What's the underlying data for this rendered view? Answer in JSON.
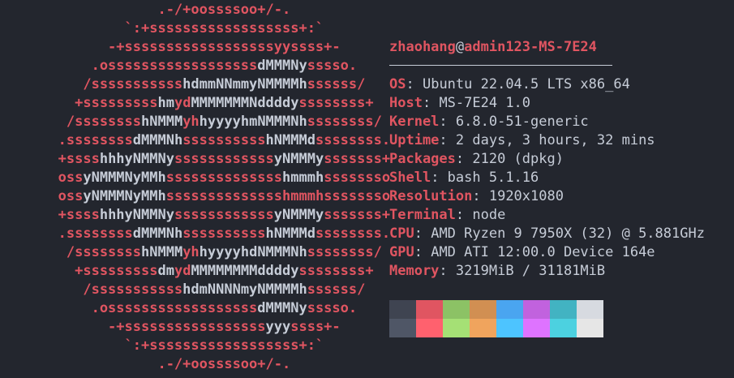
{
  "logo": {
    "lines": [
      [
        [
          "r",
          "                   .-/+oossssoo+/-."
        ]
      ],
      [
        [
          "r",
          "               `:+ssssssssssssssssss+:`"
        ]
      ],
      [
        [
          "r",
          "             -+ssssssssssssssssssyyssss+-"
        ]
      ],
      [
        [
          "r",
          "           .ossssssssssssssssss"
        ],
        [
          "w",
          "dMMMNy"
        ],
        [
          "r",
          "sssso."
        ]
      ],
      [
        [
          "r",
          "          /sssssssssss"
        ],
        [
          "w",
          "hdmmNNmmyNMMMMh"
        ],
        [
          "r",
          "ssssss/"
        ]
      ],
      [
        [
          "r",
          "         +sssssssss"
        ],
        [
          "w",
          "hm"
        ],
        [
          "r",
          "yd"
        ],
        [
          "w",
          "MMMMMMMNddddy"
        ],
        [
          "r",
          "ssssssss+"
        ]
      ],
      [
        [
          "r",
          "        /ssssssss"
        ],
        [
          "w",
          "hNMMM"
        ],
        [
          "r",
          "yh"
        ],
        [
          "w",
          "hyyyyhmNMMMNh"
        ],
        [
          "r",
          "ssssssss/"
        ]
      ],
      [
        [
          "r",
          "       .ssssssss"
        ],
        [
          "w",
          "dMMMNh"
        ],
        [
          "r",
          "ssssssssss"
        ],
        [
          "w",
          "hNMMMd"
        ],
        [
          "r",
          "ssssssss."
        ]
      ],
      [
        [
          "r",
          "       +ssss"
        ],
        [
          "w",
          "hhhyNMMNy"
        ],
        [
          "r",
          "ssssssssssss"
        ],
        [
          "w",
          "yNMMMy"
        ],
        [
          "r",
          "sssssss+"
        ]
      ],
      [
        [
          "r",
          "       oss"
        ],
        [
          "w",
          "yNMMMNyMMh"
        ],
        [
          "r",
          "ssssssssssssss"
        ],
        [
          "w",
          "hmmmh"
        ],
        [
          "r",
          "ssssssso"
        ]
      ],
      [
        [
          "r",
          "       oss"
        ],
        [
          "w",
          "yNMMMNyMMh"
        ],
        [
          "r",
          "sssssssssssssshmmmh"
        ],
        [
          "w",
          ""
        ],
        [
          "r",
          "ssssssso"
        ]
      ],
      [
        [
          "r",
          "       +ssss"
        ],
        [
          "w",
          "hhhyNMMNy"
        ],
        [
          "r",
          "ssssssssssss"
        ],
        [
          "w",
          "yNMMMy"
        ],
        [
          "r",
          "sssssss+"
        ]
      ],
      [
        [
          "r",
          "       .ssssssss"
        ],
        [
          "w",
          "dMMMNh"
        ],
        [
          "r",
          "ssssssssss"
        ],
        [
          "w",
          "hNMMMd"
        ],
        [
          "r",
          "ssssssss."
        ]
      ],
      [
        [
          "r",
          "        /ssssssss"
        ],
        [
          "w",
          "hNMMM"
        ],
        [
          "r",
          "yh"
        ],
        [
          "w",
          "hyyyyhdNMMMNh"
        ],
        [
          "r",
          "ssssssss/"
        ]
      ],
      [
        [
          "r",
          "         +sssssssss"
        ],
        [
          "w",
          "dm"
        ],
        [
          "r",
          "yd"
        ],
        [
          "w",
          "MMMMMMMMddddy"
        ],
        [
          "r",
          "ssssssss+"
        ]
      ],
      [
        [
          "r",
          "          /sssssssssss"
        ],
        [
          "w",
          "hdmNNNNmyNMMMMh"
        ],
        [
          "r",
          "ssssss/"
        ]
      ],
      [
        [
          "r",
          "           .ossssssssssssssssss"
        ],
        [
          "w",
          "dMMMNy"
        ],
        [
          "r",
          "sssso."
        ]
      ],
      [
        [
          "r",
          "             -+sssssssssssssssss"
        ],
        [
          "w",
          "yyy"
        ],
        [
          "r",
          "ssss+-"
        ]
      ],
      [
        [
          "r",
          "               `:+ssssssssssssssssss+:`"
        ]
      ],
      [
        [
          "r",
          "                   .-/+oossssoo+/-."
        ]
      ]
    ]
  },
  "title": {
    "user": "zhaohang",
    "at": "@",
    "host": "admin123-MS-7E24"
  },
  "info": [
    {
      "key": "OS",
      "value": "Ubuntu 22.04.5 LTS x86_64"
    },
    {
      "key": "Host",
      "value": "MS-7E24 1.0"
    },
    {
      "key": "Kernel",
      "value": "6.8.0-51-generic"
    },
    {
      "key": "Uptime",
      "value": "2 days, 3 hours, 32 mins"
    },
    {
      "key": "Packages",
      "value": "2120 (dpkg)"
    },
    {
      "key": "Shell",
      "value": "bash 5.1.16"
    },
    {
      "key": "Resolution",
      "value": "1920x1080"
    },
    {
      "key": "Terminal",
      "value": "node"
    },
    {
      "key": "CPU",
      "value": "AMD Ryzen 9 7950X (32) @ 5.881GHz"
    },
    {
      "key": "GPU",
      "value": "AMD ATI 12:00.0 Device 164e"
    },
    {
      "key": "Memory",
      "value": "3219MiB / 31181MiB"
    }
  ],
  "palette": {
    "normal": [
      "#3f4451",
      "#e05561",
      "#8cc265",
      "#d18f52",
      "#4aa5f0",
      "#c162de",
      "#42b3c2",
      "#d7dae0"
    ],
    "bright": [
      "#4f5666",
      "#ff616e",
      "#a5e075",
      "#f0a45d",
      "#4dc4ff",
      "#de73ff",
      "#4cd1e0",
      "#e6e6e6"
    ]
  }
}
